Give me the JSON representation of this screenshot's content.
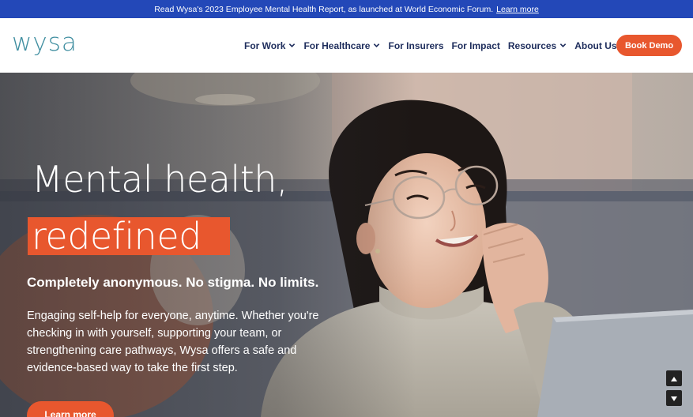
{
  "announcement": {
    "text": "Read Wysa's 2023 Employee Mental Health Report, as launched at World Economic Forum.",
    "link_label": "Learn more"
  },
  "header": {
    "logo_text": "wysa",
    "menu": [
      {
        "label": "For Work",
        "has_dropdown": true
      },
      {
        "label": "For Healthcare",
        "has_dropdown": true
      },
      {
        "label": "For Insurers",
        "has_dropdown": false
      },
      {
        "label": "For Impact",
        "has_dropdown": false
      },
      {
        "label": "Resources",
        "has_dropdown": true
      },
      {
        "label": "About Us",
        "has_dropdown": true
      }
    ],
    "cta_label": "Book Demo"
  },
  "hero": {
    "headline_line1": "Mental health,",
    "headline_line2": "redefined",
    "tagline": "Completely anonymous. No stigma. No limits.",
    "description": "Engaging self-help for everyone, anytime. Whether you're checking in with yourself, supporting your team, or strengthening care pathways, Wysa offers a safe and evidence-based way to take the first step.",
    "cta_label": "Learn more",
    "image": "smiling-woman-with-glasses-photo"
  },
  "scroll_controls": {
    "up_icon": "arrow-up-icon",
    "down_icon": "arrow-down-icon"
  },
  "colors": {
    "announcement_bg": "#2348b8",
    "accent": "#e8572e",
    "nav_text": "#1e2d5c",
    "logo": "#3f8ea0"
  }
}
